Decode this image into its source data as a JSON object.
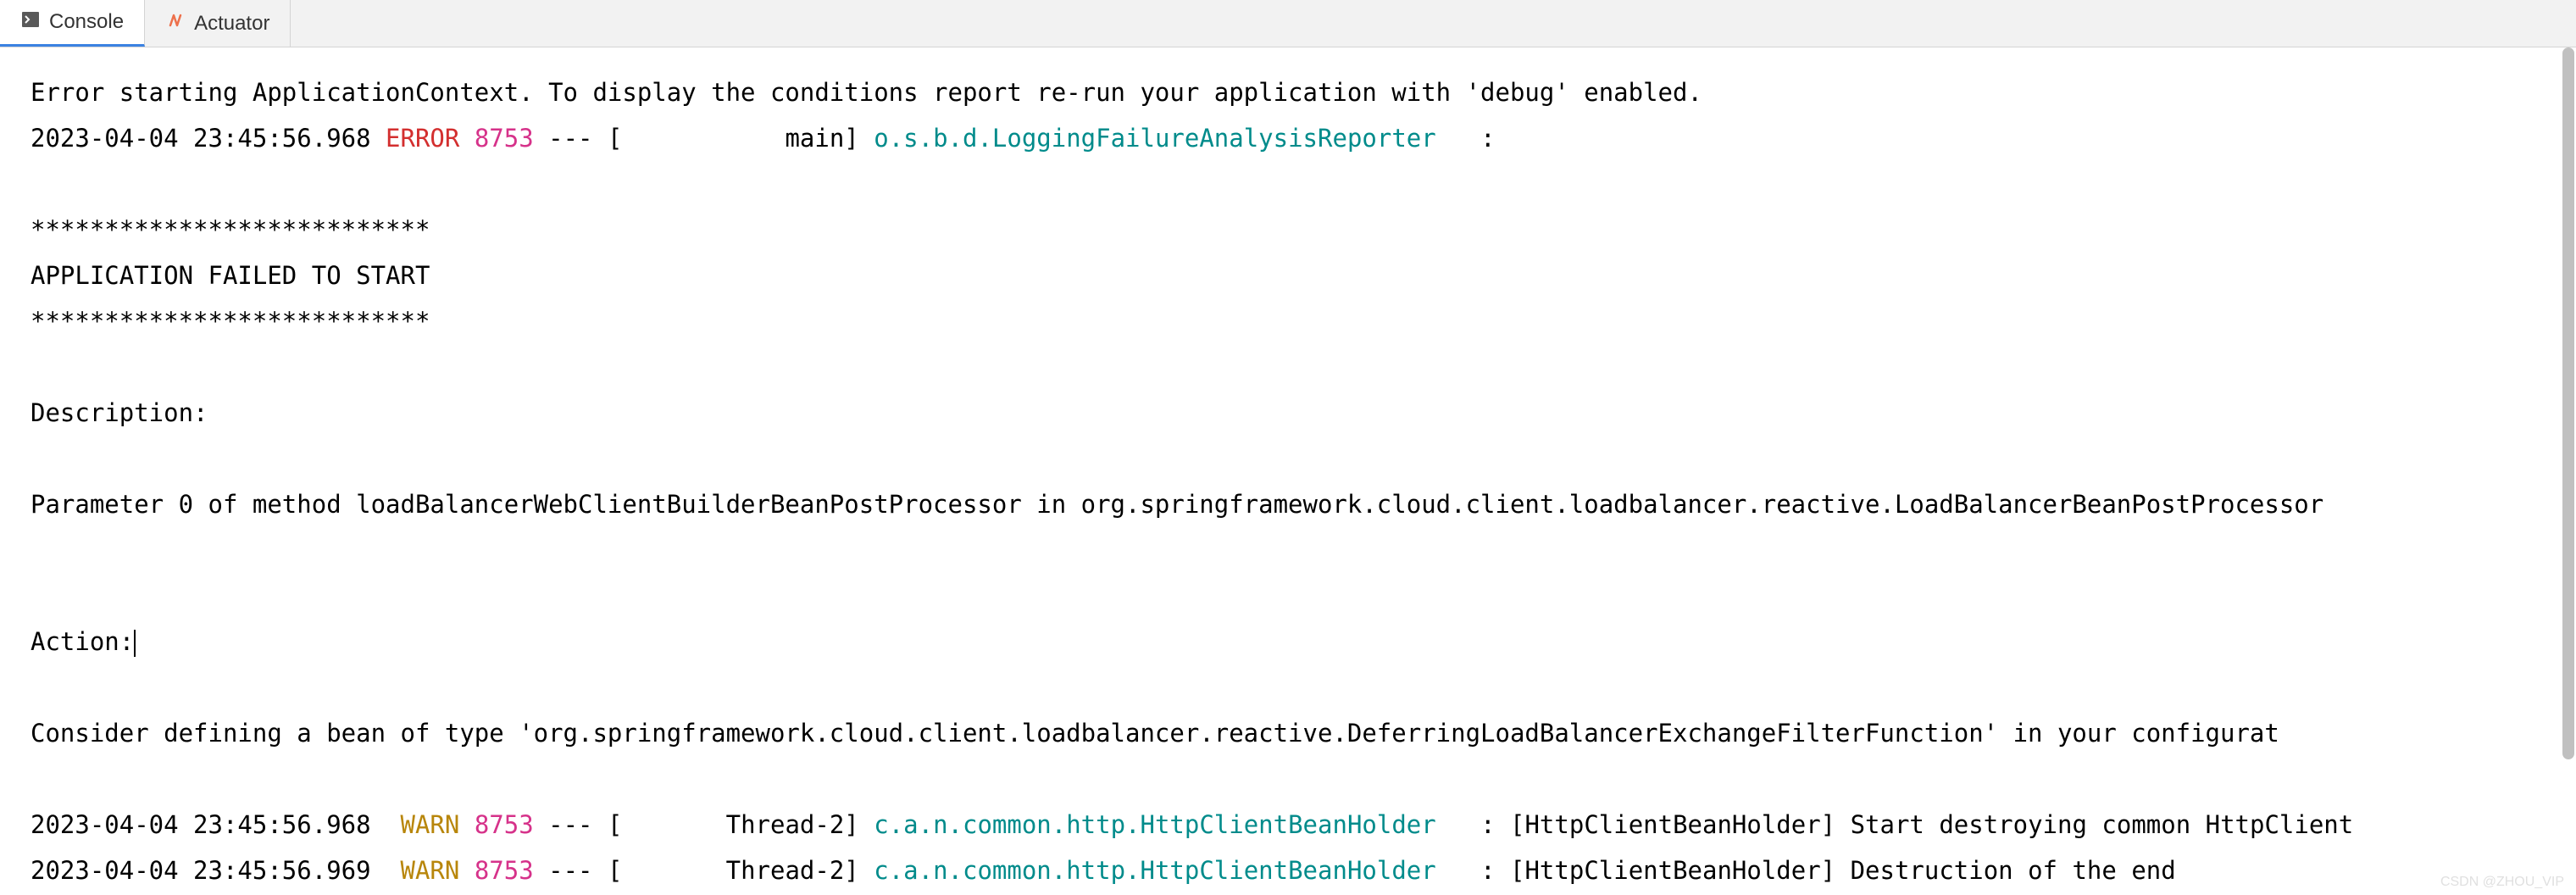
{
  "tabs": {
    "console": {
      "label": "Console"
    },
    "actuator": {
      "label": "Actuator"
    }
  },
  "console": {
    "lines": [
      {
        "plain": "Error starting ApplicationContext. To display the conditions report re-run your application with 'debug' enabled."
      },
      {
        "ts": "2023-04-04 23:45:56.968",
        "level": "ERROR",
        "pid": "8753",
        "dash": " --- [           main] ",
        "logger": "o.s.b.d.LoggingFailureAnalysisReporter  ",
        "sep": " : "
      },
      {
        "plain": ""
      },
      {
        "plain": "***************************"
      },
      {
        "plain": "APPLICATION FAILED TO START"
      },
      {
        "plain": "***************************"
      },
      {
        "plain": ""
      },
      {
        "plain": "Description:"
      },
      {
        "plain": ""
      },
      {
        "plain": "Parameter 0 of method loadBalancerWebClientBuilderBeanPostProcessor in org.springframework.cloud.client.loadbalancer.reactive.LoadBalancerBeanPostProcessor"
      },
      {
        "plain": ""
      },
      {
        "plain": ""
      },
      {
        "action": "Action:"
      },
      {
        "plain": ""
      },
      {
        "plain": "Consider defining a bean of type 'org.springframework.cloud.client.loadbalancer.reactive.DeferringLoadBalancerExchangeFilterFunction' in your configurat"
      },
      {
        "plain": ""
      },
      {
        "ts": "2023-04-04 23:45:56.968",
        "level": " WARN",
        "pid": "8753",
        "dash": " --- [       Thread-2] ",
        "logger": "c.a.n.common.http.HttpClientBeanHolder  ",
        "sep": " : ",
        "msg": "[HttpClientBeanHolder] Start destroying common HttpClient"
      },
      {
        "ts": "2023-04-04 23:45:56.969",
        "level": " WARN",
        "pid": "8753",
        "dash": " --- [       Thread-2] ",
        "logger": "c.a.n.common.http.HttpClientBeanHolder  ",
        "sep": " : ",
        "msg": "[HttpClientBeanHolder] Destruction of the end"
      }
    ]
  },
  "watermark": "CSDN @ZHOU_VIP"
}
